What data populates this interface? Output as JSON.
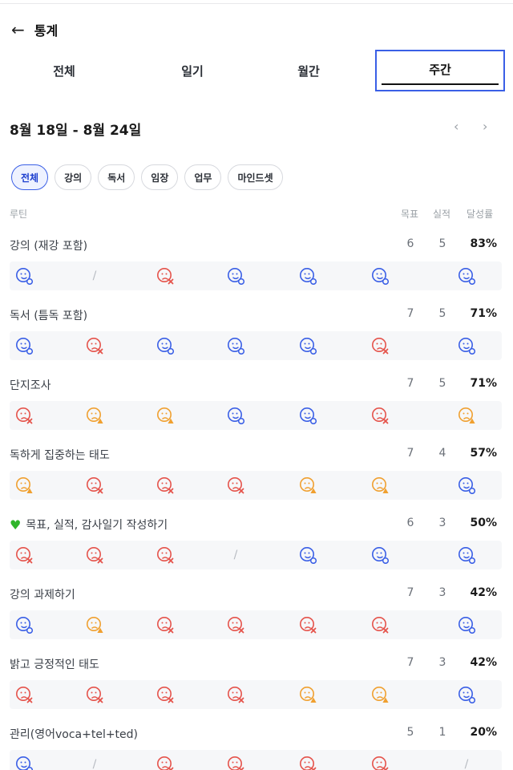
{
  "header": {
    "back_icon": "arrow-left-icon",
    "title": "통계"
  },
  "tabs": [
    {
      "label": "전체",
      "active": false
    },
    {
      "label": "일기",
      "active": false
    },
    {
      "label": "월간",
      "active": false
    },
    {
      "label": "주간",
      "active": true
    }
  ],
  "week": {
    "range": "8월 18일 - 8월 24일",
    "prev_icon": "chevron-left-icon",
    "next_icon": "chevron-right-icon"
  },
  "filters": [
    {
      "label": "전체",
      "active": true
    },
    {
      "label": "강의",
      "active": false
    },
    {
      "label": "독서",
      "active": false
    },
    {
      "label": "임장",
      "active": false
    },
    {
      "label": "업무",
      "active": false
    },
    {
      "label": "마인드셋",
      "active": false
    }
  ],
  "columns": {
    "routine": "루틴",
    "goal": "목표",
    "actual": "실적",
    "rate": "달성률"
  },
  "colors": {
    "success": "#3a5fe6",
    "fail": "#e5534b",
    "partial": "#f0a030",
    "accent": "#3a5fe6"
  },
  "routines": [
    {
      "name": "강의 (재강 포함)",
      "goal": "6",
      "actual": "5",
      "rate": "83%",
      "days": [
        "success",
        "none",
        "fail",
        "success",
        "success",
        "success",
        "success"
      ]
    },
    {
      "name": "독서 (틈독 포함)",
      "goal": "7",
      "actual": "5",
      "rate": "71%",
      "days": [
        "success",
        "fail",
        "success",
        "success",
        "success",
        "fail",
        "success"
      ]
    },
    {
      "name": "단지조사",
      "goal": "7",
      "actual": "5",
      "rate": "71%",
      "days": [
        "fail",
        "partial",
        "partial",
        "success",
        "success",
        "fail",
        "partial"
      ]
    },
    {
      "name": "독하게 집중하는 태도",
      "goal": "7",
      "actual": "4",
      "rate": "57%",
      "days": [
        "partial",
        "fail",
        "fail",
        "fail",
        "partial",
        "partial",
        "success"
      ]
    },
    {
      "name": "목표, 실적, 감사일기 작성하기",
      "heart": true,
      "goal": "6",
      "actual": "3",
      "rate": "50%",
      "days": [
        "fail",
        "fail",
        "fail",
        "none",
        "success",
        "success",
        "success"
      ]
    },
    {
      "name": "강의 과제하기",
      "goal": "7",
      "actual": "3",
      "rate": "42%",
      "days": [
        "success",
        "partial",
        "fail",
        "fail",
        "fail",
        "fail",
        "success"
      ]
    },
    {
      "name": "밝고 긍정적인 태도",
      "goal": "7",
      "actual": "3",
      "rate": "42%",
      "days": [
        "fail",
        "fail",
        "fail",
        "fail",
        "partial",
        "partial",
        "success"
      ]
    },
    {
      "name": "관리(영어voca+tel+ted)",
      "goal": "5",
      "actual": "1",
      "rate": "20%",
      "days": [
        "success",
        "none",
        "fail",
        "fail",
        "fail",
        "fail",
        "none"
      ]
    }
  ]
}
